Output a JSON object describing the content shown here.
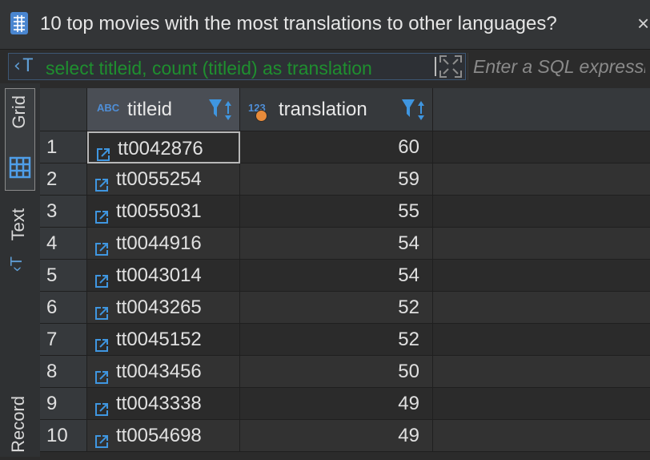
{
  "window": {
    "title": "10 top movies with the most translations to other languages?",
    "close_glyph": "×"
  },
  "filter": {
    "query_text": "select titleid, count (titleid) as translation",
    "sql_placeholder": "Enter a SQL expression"
  },
  "sidebar": {
    "tabs": [
      {
        "label": "Grid",
        "icon": "grid-icon",
        "active": true
      },
      {
        "label": "Text",
        "icon": "text-icon",
        "active": false
      },
      {
        "label": "Record",
        "icon": "record-icon",
        "active": false
      }
    ]
  },
  "table": {
    "columns": [
      {
        "type_badge": "ABC",
        "name": "titleid"
      },
      {
        "type_badge": "123",
        "name": "translation"
      }
    ],
    "rows": [
      {
        "num": "1",
        "titleid": "tt0042876",
        "translation": "60"
      },
      {
        "num": "2",
        "titleid": "tt0055254",
        "translation": "59"
      },
      {
        "num": "3",
        "titleid": "tt0055031",
        "translation": "55"
      },
      {
        "num": "4",
        "titleid": "tt0044916",
        "translation": "54"
      },
      {
        "num": "5",
        "titleid": "tt0043014",
        "translation": "54"
      },
      {
        "num": "6",
        "titleid": "tt0043265",
        "translation": "52"
      },
      {
        "num": "7",
        "titleid": "tt0045152",
        "translation": "52"
      },
      {
        "num": "8",
        "titleid": "tt0043456",
        "translation": "50"
      },
      {
        "num": "9",
        "titleid": "tt0043338",
        "translation": "49"
      },
      {
        "num": "10",
        "titleid": "tt0054698",
        "translation": "49"
      }
    ],
    "selected_row": 0
  },
  "colors": {
    "accent": "#4f8fd8",
    "query_green": "#1f8f2f",
    "badge_orange": "#e88b3a"
  }
}
